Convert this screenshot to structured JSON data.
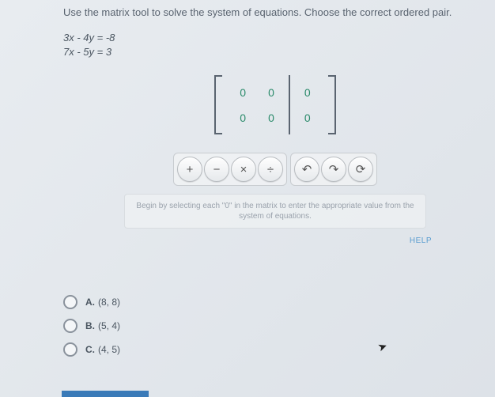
{
  "instruction": "Use the matrix tool to solve the system of equations. Choose the correct ordered pair.",
  "equations": {
    "eq1": "3x - 4y = -8",
    "eq2": "7x - 5y = 3"
  },
  "matrix": {
    "rows": [
      {
        "a": "0",
        "b": "0",
        "c": "0"
      },
      {
        "a": "0",
        "b": "0",
        "c": "0"
      }
    ]
  },
  "toolbar": {
    "plus": "+",
    "minus": "−",
    "times": "×",
    "divide": "÷",
    "undo": "↶",
    "redo": "↷",
    "reset": "⟳"
  },
  "hint": "Begin by selecting each \"0\" in the matrix to enter the appropriate value from the system of equations.",
  "help_label": "HELP",
  "answers": {
    "a": {
      "label": "A.",
      "value": "(8, 8)"
    },
    "b": {
      "label": "B.",
      "value": "(5, 4)"
    },
    "c": {
      "label": "C.",
      "value": "(4, 5)"
    }
  }
}
